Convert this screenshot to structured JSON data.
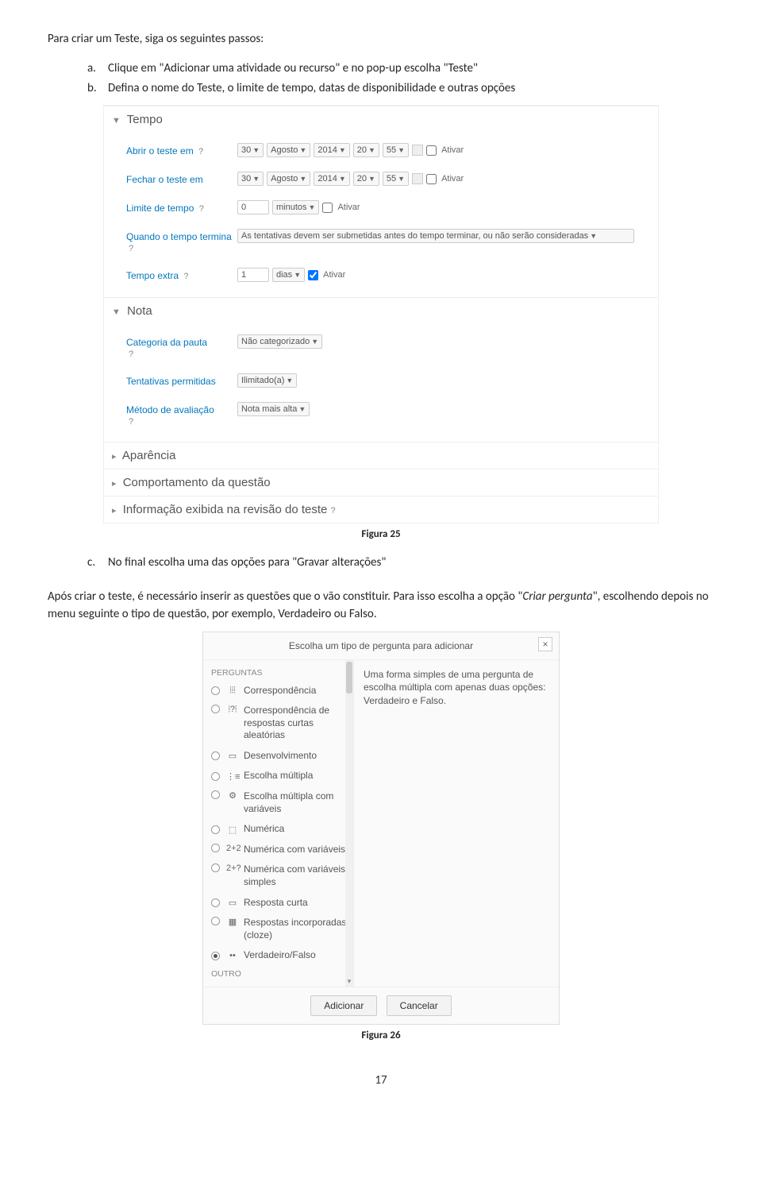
{
  "intro": "Para criar um Teste, siga os seguintes passos:",
  "steps": {
    "a": {
      "letter": "a.",
      "text": "Clique em \"Adicionar uma atividade ou recurso\" e no pop-up escolha \"Teste\""
    },
    "b": {
      "letter": "b.",
      "text": "Defina o nome do Teste, o limite de tempo, datas de disponibilidade e outras opções"
    },
    "c": {
      "letter": "c.",
      "text": "No final escolha uma das opções para \"Gravar alterações\""
    }
  },
  "shot1": {
    "tempo_header": "Tempo",
    "abrir_label": "Abrir o teste em",
    "fechar_label": "Fechar o teste em",
    "limite_label": "Limite de tempo",
    "quando_label": "Quando o tempo termina",
    "tempoextra_label": "Tempo extra",
    "help": "?",
    "day": "30",
    "month": "Agosto",
    "year": "2014",
    "hour": "20",
    "minute": "55",
    "ativar": "Ativar",
    "limite_val": "0",
    "minutos": "minutos",
    "quando_val": "As tentativas devem ser submetidas antes do tempo terminar, ou não serão consideradas",
    "tempoextra_val": "1",
    "dias": "dias",
    "nota_header": "Nota",
    "categoria_label": "Categoria da pauta",
    "categoria_val": "Não categorizado",
    "tentativas_label": "Tentativas permitidas",
    "tentativas_val": "Ilimitado(a)",
    "metodo_label": "Método de avaliação",
    "metodo_val": "Nota mais alta",
    "aparencia": "Aparência",
    "comportamento": "Comportamento da questão",
    "informacao": "Informação exibida na revisão do teste"
  },
  "fig25": "Figura 25",
  "para2_pre": "Após criar o teste, é necessário inserir as questões que o vão constituir. Para isso escolha a opção \"",
  "para2_ital": "Criar pergunta",
  "para2_post": "\", escolhendo depois no menu seguinte o tipo de questão, por exemplo, Verdadeiro ou Falso.",
  "modal": {
    "title": "Escolha um tipo de pergunta para adicionar",
    "close": "×",
    "perguntas": "PERGUNTAS",
    "outro": "OUTRO",
    "items": [
      {
        "label": "Correspondência",
        "icon": "⦙⦙⦙"
      },
      {
        "label": "Correspondência de respostas curtas aleatórias",
        "icon": "⦙?⦙"
      },
      {
        "label": "Desenvolvimento",
        "icon": "▭"
      },
      {
        "label": "Escolha múltipla",
        "icon": "⋮≡"
      },
      {
        "label": "Escolha múltipla com variáveis",
        "icon": "⚙"
      },
      {
        "label": "Numérica",
        "icon": "⬚"
      },
      {
        "label": "Numérica com variáveis",
        "icon": "2+2"
      },
      {
        "label": "Numérica com variáveis simples",
        "icon": "2+?"
      },
      {
        "label": "Resposta curta",
        "icon": "▭"
      },
      {
        "label": "Respostas incorporadas (cloze)",
        "icon": "▦"
      },
      {
        "label": "Verdadeiro/Falso",
        "icon": "••"
      }
    ],
    "desc": "Uma forma simples de uma pergunta de escolha múltipla com apenas duas opções: Verdadeiro e Falso.",
    "adicionar": "Adicionar",
    "cancelar": "Cancelar"
  },
  "fig26": "Figura 26",
  "page_num": "17"
}
